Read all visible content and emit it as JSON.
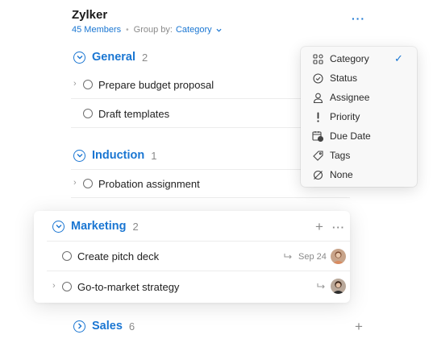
{
  "header": {
    "title": "Zylker",
    "members": "45 Members",
    "group_by_label": "Group by:",
    "group_by_value": "Category",
    "more": "···"
  },
  "groups": [
    {
      "name": "General",
      "count": "2",
      "tasks": [
        {
          "name": "Prepare budget proposal",
          "has_subtasks": true
        },
        {
          "name": "Draft templates",
          "has_subtasks": false
        }
      ]
    },
    {
      "name": "Induction",
      "count": "1",
      "tasks": [
        {
          "name": "Probation assignment",
          "has_subtasks": true
        }
      ]
    },
    {
      "name": "Marketing",
      "count": "2",
      "tasks": [
        {
          "name": "Create pitch deck",
          "has_subtasks": false,
          "due": "Sep 24"
        },
        {
          "name": "Go-to-market strategy",
          "has_subtasks": true,
          "due": ""
        }
      ]
    },
    {
      "name": "Sales",
      "count": "6",
      "tasks": []
    }
  ],
  "icons": {
    "expander": "›",
    "plus": "+",
    "more": "···",
    "check": "✓"
  },
  "menu": {
    "items": [
      {
        "label": "Category",
        "icon": "category-grid-icon",
        "selected": true
      },
      {
        "label": "Status",
        "icon": "status-check-icon",
        "selected": false
      },
      {
        "label": "Assignee",
        "icon": "person-icon",
        "selected": false
      },
      {
        "label": "Priority",
        "icon": "exclamation-icon",
        "selected": false
      },
      {
        "label": "Due Date",
        "icon": "calendar-clock-icon",
        "selected": false
      },
      {
        "label": "Tags",
        "icon": "tag-icon",
        "selected": false
      },
      {
        "label": "None",
        "icon": "none-slash-icon",
        "selected": false
      }
    ]
  },
  "colors": {
    "accent": "#1a76d2",
    "text": "#222222",
    "muted": "#8a8a8a"
  }
}
